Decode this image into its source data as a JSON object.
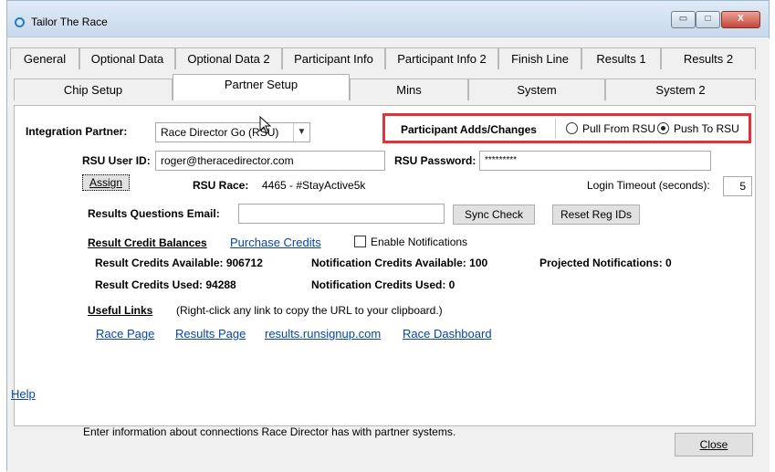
{
  "window": {
    "title": "Tailor The Race",
    "min_label": "▭",
    "max_label": "□",
    "close_label": "X"
  },
  "tabs_row1": [
    "General",
    "Optional Data",
    "Optional Data 2",
    "Participant Info",
    "Participant Info 2",
    "Finish Line",
    "Results 1",
    "Results 2"
  ],
  "tabs_row2": [
    "Chip Setup",
    "Partner Setup",
    "Mins",
    "System",
    "System 2"
  ],
  "active_tab": "Partner Setup",
  "integration": {
    "label": "Integration Partner:",
    "selected": "Race Director Go (RSU)"
  },
  "participant_adds": {
    "label": "Participant Adds/Changes",
    "option_pull": "Pull From RSU",
    "option_push": "Push To RSU",
    "selected": "Push To RSU"
  },
  "rsu": {
    "user_label": "RSU User ID:",
    "user_value": "roger@theracedirector.com",
    "password_label": "RSU Password:",
    "password_value": "*********",
    "assign_label": "Assign",
    "race_label": "RSU Race:",
    "race_value": "4465 - #StayActive5k",
    "timeout_label": "Login Timeout (seconds):",
    "timeout_value": "5"
  },
  "results_email": {
    "label": "Results Questions Email:",
    "value": "",
    "sync_label": "Sync Check",
    "reset_label": "Reset Reg IDs"
  },
  "credits": {
    "heading": "Result Credit Balances",
    "purchase_link": "Purchase Credits",
    "enable_notifications": "Enable Notifications",
    "result_available": "Result Credits Available: 906712",
    "notification_available": "Notification Credits Available: 100",
    "projected": "Projected Notifications: 0",
    "result_used": "Result Credits Used: 94288",
    "notification_used": "Notification Credits Used: 0"
  },
  "useful_links": {
    "heading": "Useful Links",
    "hint": "(Right-click any link to copy the URL to your clipboard.)",
    "links": [
      "Race Page",
      "Results Page",
      "results.runsignup.com",
      "Race Dashboard"
    ]
  },
  "help_label": "Help",
  "footer_text": "Enter information about connections Race Director has with partner systems.",
  "close_button": "Close",
  "colors": {
    "highlight": "#e0333a",
    "link": "#0645ad",
    "titlebar": "#c8d9ec"
  }
}
